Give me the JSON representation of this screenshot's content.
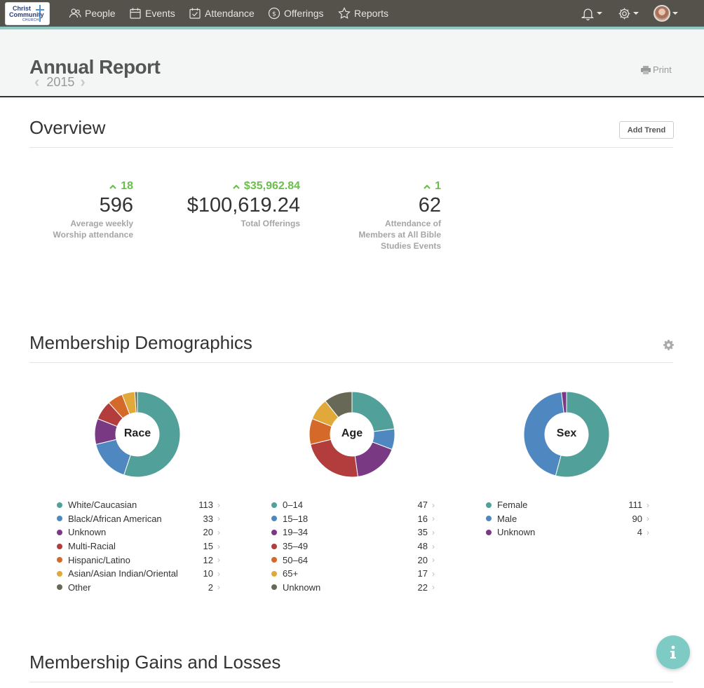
{
  "nav": {
    "logo": {
      "line1": "Christ",
      "line2": "Community",
      "line3": "CHURCH"
    },
    "items": [
      {
        "label": "People",
        "icon": "people-icon"
      },
      {
        "label": "Events",
        "icon": "calendar-icon"
      },
      {
        "label": "Attendance",
        "icon": "attendance-icon"
      },
      {
        "label": "Offerings",
        "icon": "offerings-icon"
      },
      {
        "label": "Reports",
        "icon": "star-icon"
      }
    ]
  },
  "header": {
    "title": "Annual Report",
    "year": "2015",
    "print_label": "Print"
  },
  "overview": {
    "title": "Overview",
    "add_trend_label": "Add Trend",
    "stats": [
      {
        "delta": "18",
        "value": "596",
        "label_lines": [
          "Average weekly",
          "Worship attendance"
        ]
      },
      {
        "delta": "$35,962.84",
        "value": "$100,619.24",
        "label_lines": [
          "Total Offerings"
        ]
      },
      {
        "delta": "1",
        "value": "62",
        "label_lines": [
          "Attendance of",
          "Members at All Bible",
          "Studies Events"
        ]
      }
    ]
  },
  "demographics": {
    "title": "Membership Demographics",
    "charts": [
      {
        "label": "Race",
        "rows": [
          {
            "name": "White/Caucasian",
            "value": 113,
            "color": "#52a09a"
          },
          {
            "name": "Black/African American",
            "value": 33,
            "color": "#4f88c1"
          },
          {
            "name": "Unknown",
            "value": 20,
            "color": "#7a3a83"
          },
          {
            "name": "Multi-Racial",
            "value": 15,
            "color": "#b33d3d"
          },
          {
            "name": "Hispanic/Latino",
            "value": 12,
            "color": "#d4692a"
          },
          {
            "name": "Asian/Asian Indian/Oriental",
            "value": 10,
            "color": "#e0a93a"
          },
          {
            "name": "Other",
            "value": 2,
            "color": "#686857"
          }
        ]
      },
      {
        "label": "Age",
        "rows": [
          {
            "name": "0–14",
            "value": 47,
            "color": "#52a09a"
          },
          {
            "name": "15–18",
            "value": 16,
            "color": "#4f88c1"
          },
          {
            "name": "19–34",
            "value": 35,
            "color": "#7a3a83"
          },
          {
            "name": "35–49",
            "value": 48,
            "color": "#b33d3d"
          },
          {
            "name": "50–64",
            "value": 20,
            "color": "#d4692a"
          },
          {
            "name": "65+",
            "value": 17,
            "color": "#e0a93a"
          },
          {
            "name": "Unknown",
            "value": 22,
            "color": "#686857"
          }
        ]
      },
      {
        "label": "Sex",
        "rows": [
          {
            "name": "Female",
            "value": 111,
            "color": "#52a09a"
          },
          {
            "name": "Male",
            "value": 90,
            "color": "#4f88c1"
          },
          {
            "name": "Unknown",
            "value": 4,
            "color": "#7a3a83"
          }
        ]
      }
    ]
  },
  "gains_losses": {
    "title": "Membership Gains and Losses"
  },
  "colors": {
    "nav_bg": "#55524c",
    "accent": "#8cc9c4",
    "positive": "#6abf4b",
    "fab": "#7ecbc6"
  }
}
